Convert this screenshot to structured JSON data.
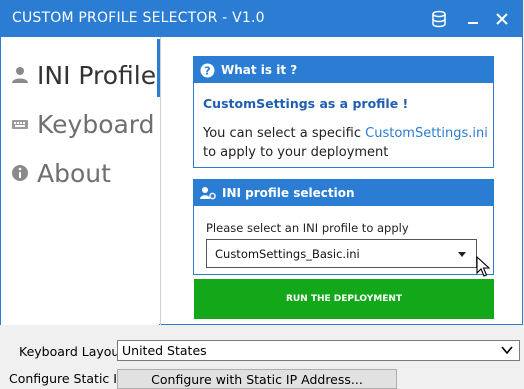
{
  "window": {
    "title": "CUSTOM PROFILE SELECTOR - V1.0",
    "icons": [
      "cylinder-icon",
      "minimize-icon",
      "close-icon"
    ]
  },
  "sidebar": {
    "items": [
      {
        "label": "INI Profile",
        "icon": "user-icon",
        "active": true
      },
      {
        "label": "Keyboard",
        "icon": "keyboard-icon",
        "active": false
      },
      {
        "label": "About",
        "icon": "info-icon",
        "active": false
      }
    ]
  },
  "info_card": {
    "header": "What is it ?",
    "subtitle": "CustomSettings as a profile !",
    "text_before": "You can select a specific ",
    "link": "CustomSettings.ini",
    "text_after": " to apply to your deployment"
  },
  "selection_card": {
    "header": "INI profile selection",
    "label": "Please select an INI profile to apply",
    "selected": "CustomSettings_Basic.ini"
  },
  "run_button": "RUN THE DEPLOYMENT",
  "bottom": {
    "keyboard_label": "Keyboard Layout",
    "keyboard_value": "United States",
    "static_ip_label": "Configure Static IP",
    "static_ip_button": "Configure with Static IP Address..."
  },
  "colors": {
    "accent": "#2b7cd3",
    "run_button": "#12a81a"
  }
}
